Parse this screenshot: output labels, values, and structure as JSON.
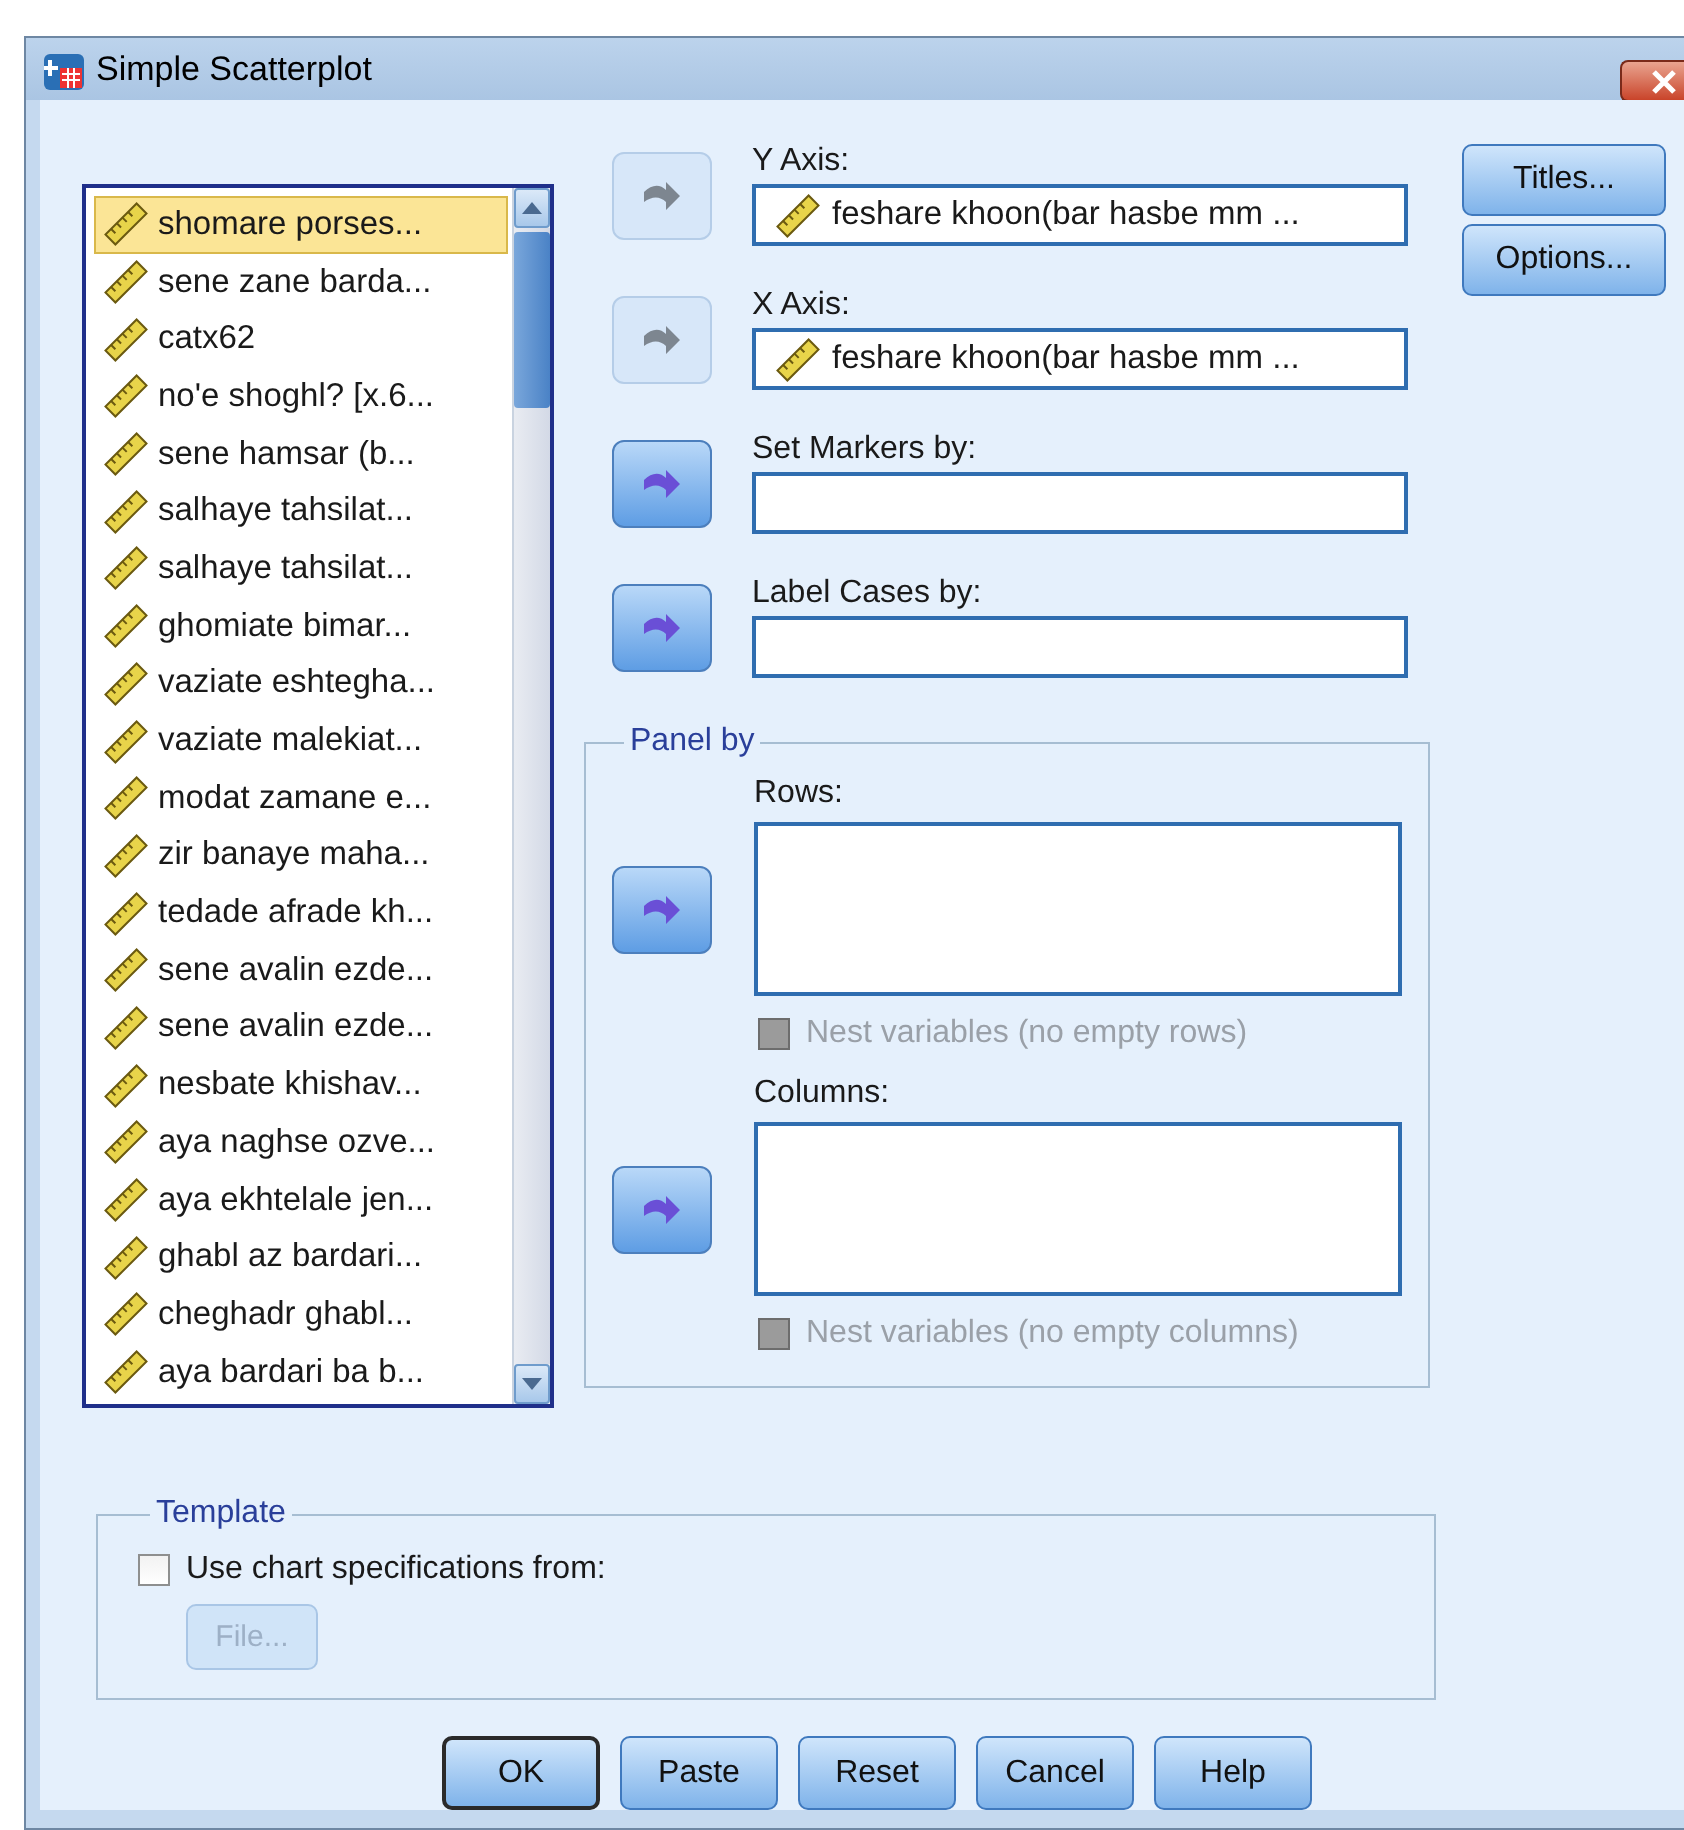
{
  "window": {
    "title": "Simple Scatterplot"
  },
  "variables": [
    {
      "name": "shomare porses...",
      "selected": true
    },
    {
      "name": "sene zane barda...",
      "selected": false
    },
    {
      "name": "catx62",
      "selected": false
    },
    {
      "name": "no'e shoghl? [x.6...",
      "selected": false
    },
    {
      "name": "sene hamsar (b...",
      "selected": false
    },
    {
      "name": "salhaye tahsilat...",
      "selected": false
    },
    {
      "name": "salhaye tahsilat...",
      "selected": false
    },
    {
      "name": "ghomiate bimar...",
      "selected": false
    },
    {
      "name": "vaziate eshtegha...",
      "selected": false
    },
    {
      "name": "vaziate malekiat...",
      "selected": false
    },
    {
      "name": "modat zamane e...",
      "selected": false
    },
    {
      "name": "zir banaye maha...",
      "selected": false
    },
    {
      "name": "tedade afrade kh...",
      "selected": false
    },
    {
      "name": "sene avalin ezde...",
      "selected": false
    },
    {
      "name": "sene avalin ezde...",
      "selected": false
    },
    {
      "name": "nesbate khishav...",
      "selected": false
    },
    {
      "name": "aya naghse ozve...",
      "selected": false
    },
    {
      "name": "aya ekhtelale jen...",
      "selected": false
    },
    {
      "name": "ghabl az bardari...",
      "selected": false
    },
    {
      "name": "cheghadr ghabl...",
      "selected": false
    },
    {
      "name": "aya bardari ba b...",
      "selected": false
    }
  ],
  "targets": [
    {
      "label": "Y Axis:",
      "value": "feshare khoon(bar hasbe mm ...",
      "arrow_enabled": false
    },
    {
      "label": "X Axis:",
      "value": "feshare khoon(bar hasbe mm ...",
      "arrow_enabled": false
    },
    {
      "label": "Set Markers by:",
      "arrow_enabled": true
    },
    {
      "label": "Label Cases by:",
      "arrow_enabled": true
    }
  ],
  "side_buttons": [
    "Titles...",
    "Options..."
  ],
  "panel_by": {
    "title": "Panel by",
    "lists": [
      {
        "label": "Rows:",
        "arrow_enabled": true,
        "nest": {
          "label": "Nest variables (no empty rows)",
          "checked": false,
          "disabled": true
        }
      },
      {
        "label": "Columns:",
        "arrow_enabled": true,
        "nest": {
          "label": "Nest variables (no empty columns)",
          "checked": false,
          "disabled": true
        }
      }
    ]
  },
  "template": {
    "title": "Template",
    "checkbox": {
      "label": "Use chart specifications from:",
      "checked": false
    },
    "file_button": {
      "label": "File...",
      "disabled": true
    }
  },
  "buttons": [
    {
      "label": "OK",
      "default": true
    },
    {
      "label": "Paste",
      "default": false
    },
    {
      "label": "Reset",
      "default": false
    },
    {
      "label": "Cancel",
      "default": false
    },
    {
      "label": "Help",
      "default": false
    }
  ]
}
